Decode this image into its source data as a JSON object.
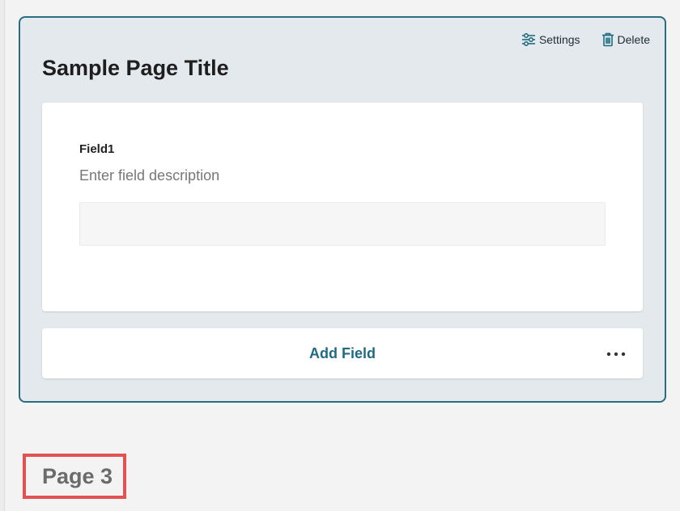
{
  "page": {
    "title": "Sample Page Title"
  },
  "toolbar": {
    "settings_label": "Settings",
    "delete_label": "Delete"
  },
  "field": {
    "label": "Field1",
    "description": "Enter field description",
    "value": ""
  },
  "actions": {
    "add_field_label": "Add Field",
    "more_icon": "more-horizontal-icon"
  },
  "footer": {
    "page_label": "Page 3"
  },
  "colors": {
    "accent": "#2a6c80",
    "link": "#1f6b83",
    "card_bg": "#e3e9ec",
    "highlight": "#e35252"
  }
}
